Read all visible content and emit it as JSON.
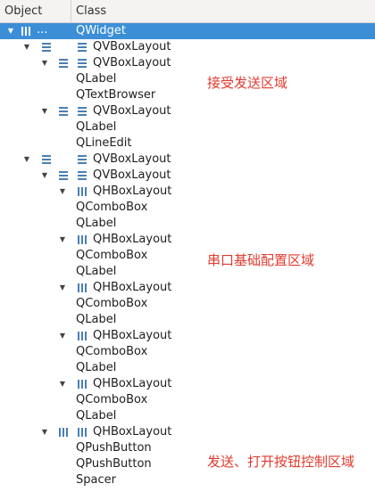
{
  "header": {
    "object": "Object",
    "class": "Class"
  },
  "root": {
    "label": "QWidget",
    "object_text": "..."
  },
  "rows": [
    {
      "text": "QVBoxLayout"
    },
    {
      "text": "QVBoxLayout"
    },
    {
      "text": "QLabel"
    },
    {
      "text": "QTextBrowser"
    },
    {
      "text": "QVBoxLayout"
    },
    {
      "text": "QLabel"
    },
    {
      "text": "QLineEdit"
    },
    {
      "text": "QVBoxLayout"
    },
    {
      "text": "QVBoxLayout"
    },
    {
      "text": "QHBoxLayout"
    },
    {
      "text": "QComboBox"
    },
    {
      "text": "QLabel"
    },
    {
      "text": "QHBoxLayout"
    },
    {
      "text": "QComboBox"
    },
    {
      "text": "QLabel"
    },
    {
      "text": "QHBoxLayout"
    },
    {
      "text": "QComboBox"
    },
    {
      "text": "QLabel"
    },
    {
      "text": "QHBoxLayout"
    },
    {
      "text": "QComboBox"
    },
    {
      "text": "QLabel"
    },
    {
      "text": "QHBoxLayout"
    },
    {
      "text": "QComboBox"
    },
    {
      "text": "QLabel"
    },
    {
      "text": "QHBoxLayout"
    },
    {
      "text": "QPushButton"
    },
    {
      "text": "QPushButton"
    },
    {
      "text": "Spacer"
    }
  ],
  "annotations": {
    "receive_area": "接受发送区域",
    "serial_config_area": "串口基础配置区域",
    "send_control_area": "发送、打开按钮控制区域"
  },
  "colors": {
    "selection": "#3c8fd6",
    "annotation": "#e03a2e",
    "icon": "#4a7fb5"
  }
}
